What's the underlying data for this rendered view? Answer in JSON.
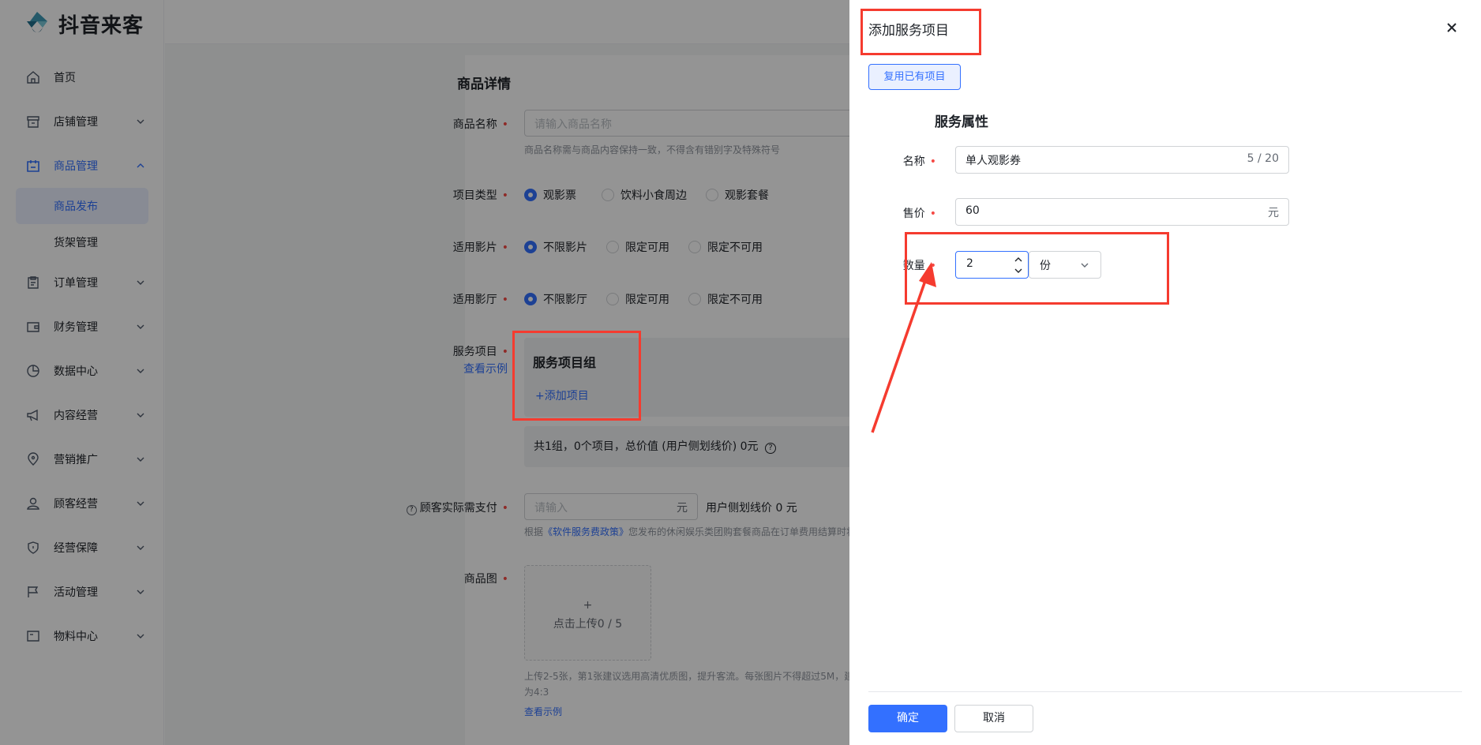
{
  "app": {
    "logo_text": "抖音来客"
  },
  "sidebar": {
    "items": [
      {
        "label": "首页",
        "icon": "home-icon"
      },
      {
        "label": "店铺管理",
        "icon": "store-icon"
      },
      {
        "label": "商品管理",
        "icon": "product-icon"
      },
      {
        "label": "订单管理",
        "icon": "order-icon"
      },
      {
        "label": "财务管理",
        "icon": "wallet-icon"
      },
      {
        "label": "数据中心",
        "icon": "chart-icon"
      },
      {
        "label": "内容经营",
        "icon": "megaphone-icon"
      },
      {
        "label": "营销推广",
        "icon": "location-icon"
      },
      {
        "label": "顾客经营",
        "icon": "user-icon"
      },
      {
        "label": "经营保障",
        "icon": "shield-icon"
      },
      {
        "label": "活动管理",
        "icon": "flag-icon"
      },
      {
        "label": "物料中心",
        "icon": "material-icon"
      }
    ],
    "sub_items": [
      "商品发布",
      "货架管理"
    ],
    "active_sub": "商品发布"
  },
  "form": {
    "section_title": "商品详情",
    "name_label": "商品名称",
    "name_placeholder": "请输入商品名称",
    "name_hint": "商品名称需与商品内容保持一致，不得含有错别字及特殊符号",
    "type_label": "项目类型",
    "type_options": [
      "观影票",
      "饮料小食周边",
      "观影套餐"
    ],
    "film_label": "适用影片",
    "film_options": [
      "不限影片",
      "限定可用",
      "限定不可用"
    ],
    "hall_label": "适用影厅",
    "hall_options": [
      "不限影厅",
      "限定可用",
      "限定不可用"
    ],
    "service_label": "服务项目",
    "service_example": "查看示例",
    "service_group_title": "服务项目组",
    "service_add": "+添加项目",
    "service_summary": "共1组，0个项目，总价值 (用户侧划线价) 0元",
    "pay_label": "顾客实际需支付",
    "pay_placeholder": "请输入",
    "pay_unit": "元",
    "strike_price": "用户侧划线价 0 元",
    "policy_hint_prefix": "根据",
    "policy_link": "《软件服务费政策》",
    "policy_hint_suffix": "您发布的休闲娱乐类团购套餐商品在订单费用结算时将",
    "image_label": "商品图",
    "upload_plus": "+",
    "upload_text": "点击上传0 / 5",
    "upload_hint_1": "上传2-5张，第1张建议选用高清优质图，提升客流。每张图片不得超过5M，建",
    "upload_hint_2": "为4:3",
    "upload_example": "查看示例"
  },
  "drawer": {
    "title": "添加服务项目",
    "reuse_button": "复用已有项目",
    "section_title": "服务属性",
    "name_label": "名称",
    "name_value": "单人观影券",
    "name_count": "5 / 20",
    "price_label": "售价",
    "price_value": "60",
    "price_unit": "元",
    "qty_label": "数量",
    "qty_value": "2",
    "unit_value": "份",
    "ok_button": "确定",
    "cancel_button": "取消"
  },
  "colors": {
    "accent": "#3370ff",
    "annotation_red": "#f53b2f",
    "required": "#f54a45"
  }
}
